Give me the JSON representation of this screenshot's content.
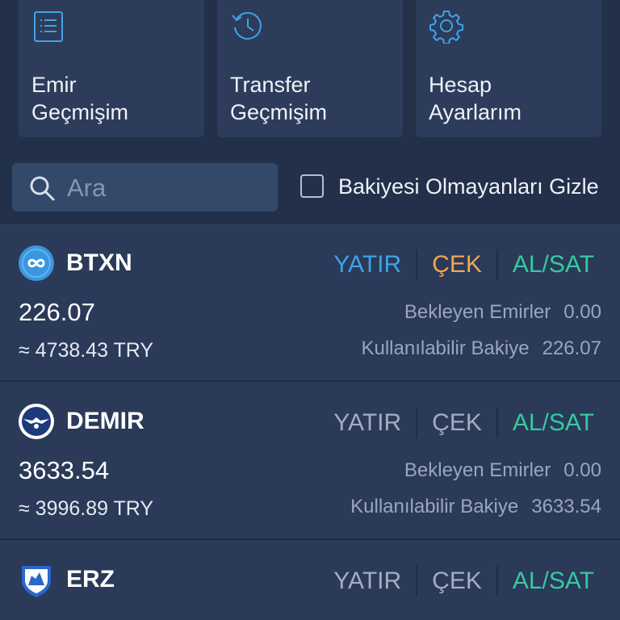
{
  "tiles": [
    {
      "line1": "Emir",
      "line2": "Geçmişim",
      "icon": "document-list-icon"
    },
    {
      "line1": "Transfer",
      "line2": "Geçmişim",
      "icon": "history-icon"
    },
    {
      "line1": "Hesap",
      "line2": "Ayarlarım",
      "icon": "gear-icon"
    }
  ],
  "search": {
    "placeholder": "Ara",
    "icon": "search-icon"
  },
  "filter": {
    "label": "Bakiyesi Olmayanları Gizle",
    "checked": false
  },
  "colors": {
    "accent_blue": "#3fa3e8",
    "accent_orange": "#f0a650",
    "accent_green": "#37c9a0",
    "muted": "#a3adbf",
    "background": "#2a3a58",
    "panel": "#223049"
  },
  "assets": [
    {
      "symbol": "BTXN",
      "logo": "infinity-logo-icon",
      "actions": {
        "deposit": "YATIR",
        "withdraw": "ÇEK",
        "trade": "AL/SAT"
      },
      "enabled": true,
      "amount": "226.07",
      "approx_try": "≈ 4738.43 TRY",
      "pending_label": "Bekleyen Emirler",
      "pending_value": "0.00",
      "available_label": "Kullanılabilir Bakiye",
      "available_value": "226.07"
    },
    {
      "symbol": "DEMIR",
      "logo": "winged-shield-logo-icon",
      "actions": {
        "deposit": "YATIR",
        "withdraw": "ÇEK",
        "trade": "AL/SAT"
      },
      "enabled": false,
      "amount": "3633.54",
      "approx_try": "≈ 3996.89 TRY",
      "pending_label": "Bekleyen Emirler",
      "pending_value": "0.00",
      "available_label": "Kullanılabilir Bakiye",
      "available_value": "3633.54"
    },
    {
      "symbol": "ERZ",
      "logo": "erzurum-crest-logo-icon",
      "actions": {
        "deposit": "YATIR",
        "withdraw": "ÇEK",
        "trade": "AL/SAT"
      },
      "enabled": false
    }
  ]
}
